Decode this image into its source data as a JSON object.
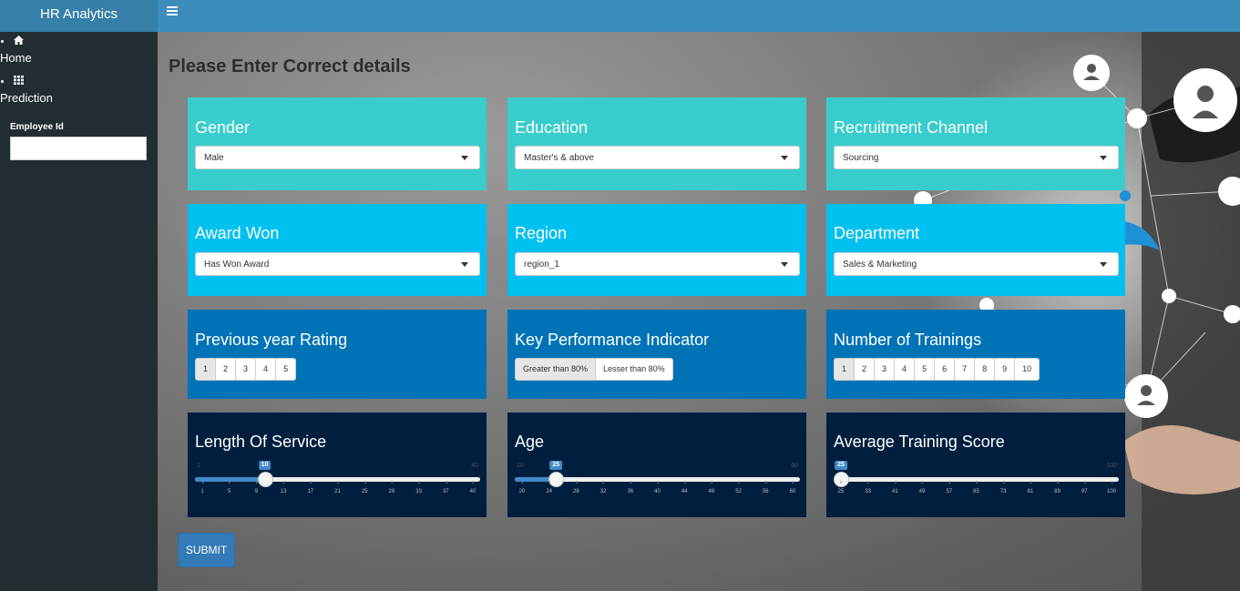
{
  "app": {
    "title": "HR Analytics"
  },
  "sidebar": {
    "items": [
      {
        "label": "Home",
        "icon": "home-icon"
      },
      {
        "label": "Prediction",
        "icon": "grid-icon"
      }
    ],
    "employee_id": {
      "label": "Employee Id",
      "value": ""
    }
  },
  "main": {
    "page_title": "Please Enter Correct details",
    "gender": {
      "title": "Gender",
      "selected": "Male"
    },
    "education": {
      "title": "Education",
      "selected": "Master's & above"
    },
    "recruitment": {
      "title": "Recruitment Channel",
      "selected": "Sourcing"
    },
    "award": {
      "title": "Award Won",
      "selected": "Has Won Award"
    },
    "region": {
      "title": "Region",
      "selected": "region_1"
    },
    "department": {
      "title": "Department",
      "selected": "Sales & Marketing"
    },
    "rating": {
      "title": "Previous year Rating",
      "options": [
        "1",
        "2",
        "3",
        "4",
        "5"
      ]
    },
    "kpi": {
      "title": "Key Performance Indicator",
      "options": [
        "Greater than 80%",
        "Lesser than 80%"
      ]
    },
    "trainings": {
      "title": "Number of Trainings",
      "options": [
        "1",
        "2",
        "3",
        "4",
        "5",
        "6",
        "7",
        "8",
        "9",
        "10"
      ]
    },
    "service": {
      "title": "Length Of Service",
      "min": 1,
      "max": 40,
      "value": 10,
      "ticks": [
        "1",
        "5",
        "9",
        "13",
        "17",
        "21",
        "25",
        "29",
        "33",
        "37",
        "40"
      ]
    },
    "age": {
      "title": "Age",
      "min": 20,
      "max": 60,
      "value": 25,
      "ticks": [
        "20",
        "24",
        "28",
        "32",
        "36",
        "40",
        "44",
        "48",
        "52",
        "56",
        "60"
      ]
    },
    "score": {
      "title": "Average Training Score",
      "min": 25,
      "max": 100,
      "value": 25,
      "ticks": [
        "25",
        "33",
        "41",
        "49",
        "57",
        "65",
        "73",
        "81",
        "89",
        "97",
        "100"
      ]
    },
    "submit_label": "SUBMIT"
  },
  "colors": {
    "header": "#3c8dbc",
    "logo": "#367fa9",
    "sidebar": "#222d32",
    "teal": "#39cccc",
    "aqua": "#00c0ef",
    "blue": "#0073b7",
    "navy": "#001f3f",
    "slider": "#428bca"
  }
}
